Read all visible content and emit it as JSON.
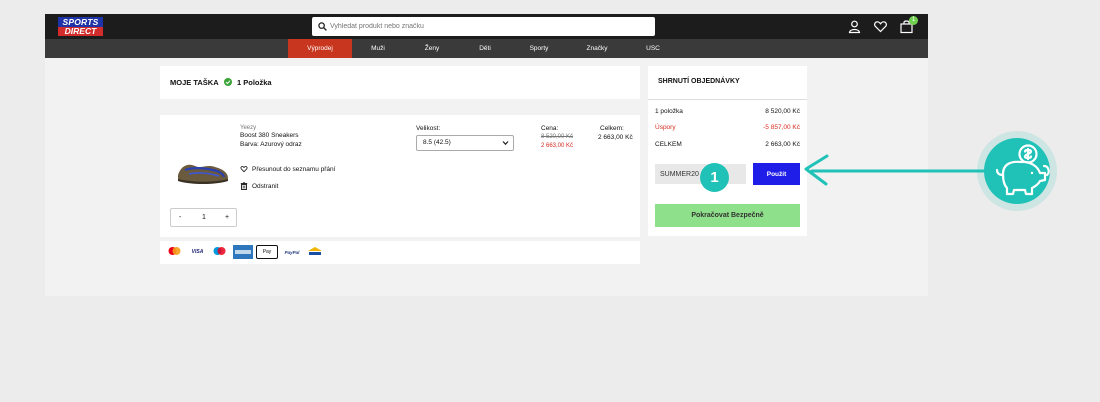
{
  "header": {
    "logo_top": "SPORTS",
    "logo_bottom": "DIRECT",
    "search_placeholder": "Vyhledat produkt nebo značku",
    "cart_count": "1"
  },
  "nav": {
    "items": [
      "Výprodej",
      "Muži",
      "Ženy",
      "Děti",
      "Sporty",
      "Značky",
      "USC"
    ],
    "active": "Výprodej"
  },
  "bag": {
    "title": "MOJE TAŠKA",
    "count": "1 Položka"
  },
  "item": {
    "brand": "Yeezy",
    "name": "Boost 380 Sneakers",
    "color": "Barva: Azurový odraz",
    "size_label": "Velikost:",
    "size_value": "8.5 (42.5)",
    "price_label": "Cena:",
    "price_old": "8 520,00 Kč",
    "price_new": "2 663,00 Kč",
    "total_label": "Celkem:",
    "total_value": "2 663,00 Kč",
    "wishlist_label": "Přesunout do seznamu přání",
    "remove_label": "Odstranit",
    "qty_minus": "-",
    "qty_value": "1",
    "qty_plus": "+"
  },
  "payments": [
    "VISA",
    "Pay",
    "PayPal"
  ],
  "summary": {
    "title": "SHRNUTÍ OBJEDNÁVKY",
    "items_label": "1 položka",
    "items_value": "8 520,00 Kč",
    "savings_label": "Úspory",
    "savings_value": "-5 857,00 Kč",
    "total_label": "CELKEM",
    "total_value": "2 663,00 Kč",
    "promo_value": "SUMMER20",
    "apply_label": "Použít",
    "continue_label": "Pokračovat Bezpečně"
  },
  "annotation": {
    "step": "1",
    "color": "#20c2b8"
  },
  "colors": {
    "accent_red": "#c8361f",
    "apply_blue": "#1f1ee8",
    "continue_green": "#8fe08a",
    "badge_green": "#6fcf4e"
  }
}
